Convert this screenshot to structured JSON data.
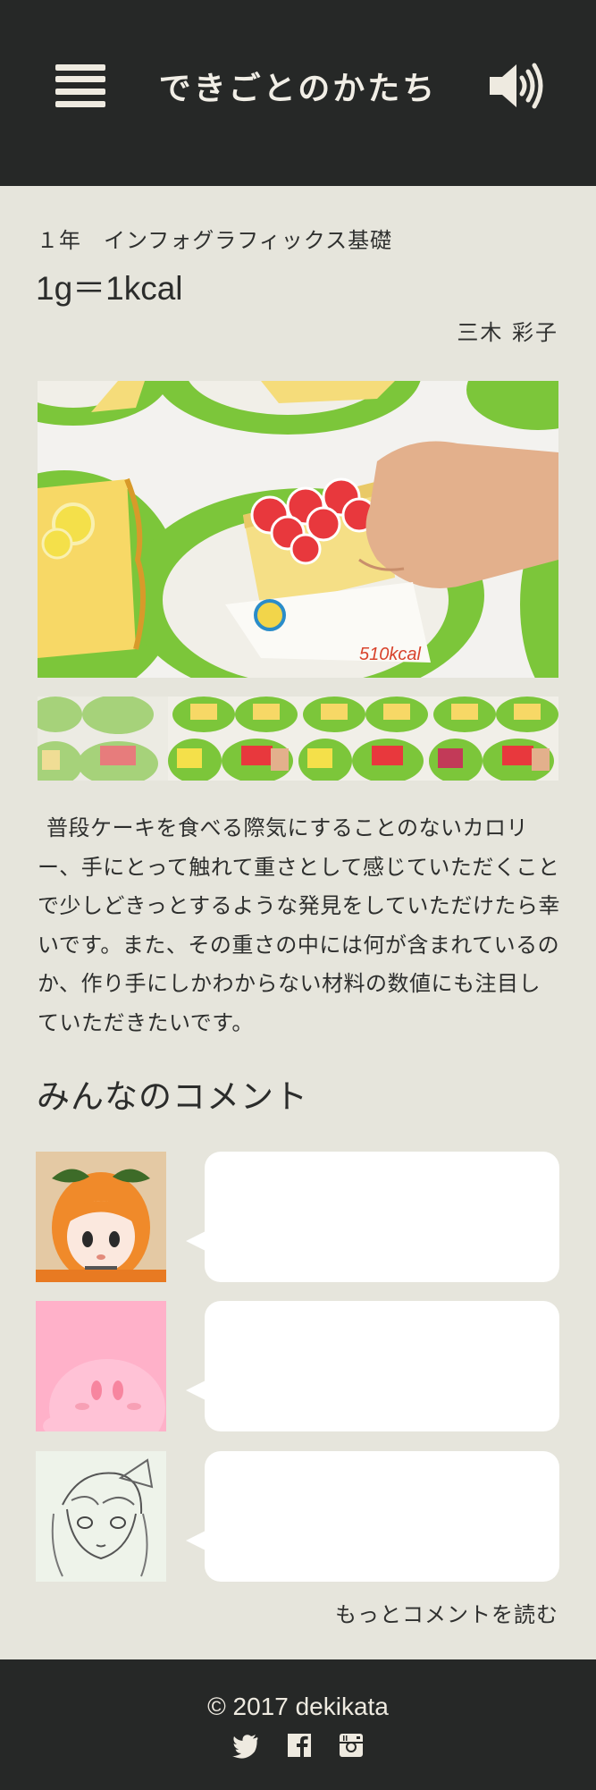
{
  "header": {
    "site_title": "できごとのかたち",
    "menu_icon": "hamburger-icon",
    "sound_icon": "speaker-icon"
  },
  "work": {
    "course": "１年　インフォグラフィックス基礎",
    "title": "1g＝1kcal",
    "author": "三木 彩子",
    "photo_label": "510kcal",
    "description": "普段ケーキを食べる際気にすることのないカロリー、手にとって触れて重さとして感じていただくことで少しどきっとするような発見をしていただけたら幸いです。また、その重さの中には何が含まれているのか、作り手にしかわからない材料の数値にも注目していただきたいです。"
  },
  "comments": {
    "heading": "みんなのコメント",
    "items": [
      {
        "avatar": "orange-hair-figure-avatar",
        "text": ""
      },
      {
        "avatar": "pink-character-avatar",
        "text": ""
      },
      {
        "avatar": "pencil-sketch-avatar",
        "text": ""
      }
    ],
    "more_label": "もっとコメントを読む"
  },
  "footer": {
    "copyright": "© 2017 dekikata",
    "social": [
      "twitter-icon",
      "facebook-icon",
      "instagram-icon"
    ]
  },
  "colors": {
    "header_bg": "#262827",
    "page_bg": "#e6e5dc",
    "header_text": "#f1eee6"
  }
}
